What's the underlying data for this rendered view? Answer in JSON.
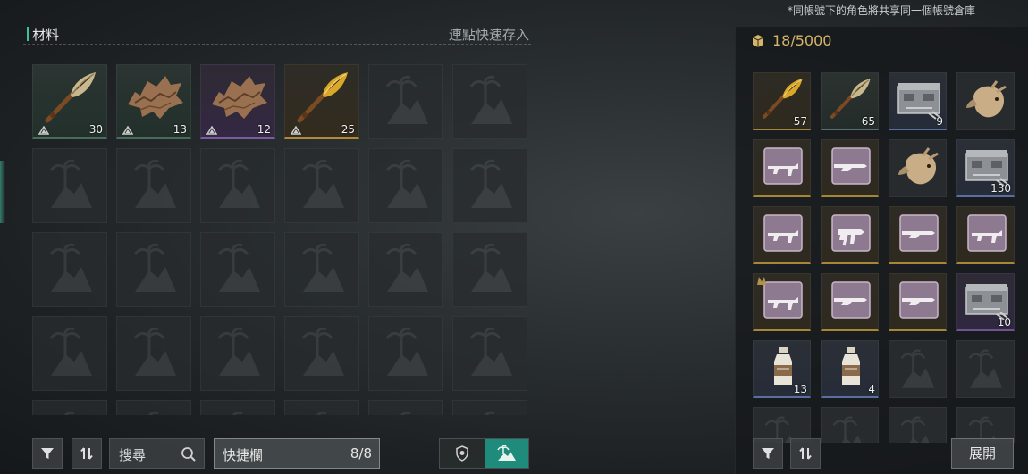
{
  "materials": {
    "title": "材料",
    "quick_store": "連點快速存入",
    "items": [
      {
        "icon": "bone-spear-icon",
        "rarity": "g",
        "count": "30"
      },
      {
        "icon": "animal-hide-icon",
        "rarity": "g",
        "count": "13"
      },
      {
        "icon": "animal-hide-icon",
        "rarity": "p",
        "count": "12"
      },
      {
        "icon": "golden-spear-icon",
        "rarity": "y",
        "count": "25"
      }
    ],
    "empty_slots": 26
  },
  "toolbar": {
    "search_label": "搜尋",
    "hotbar_label": "快捷欄",
    "hotbar_count": "8/8",
    "filter_icon": "filter-icon",
    "sort_icon": "sort-icon",
    "badge_icon": "badge-icon",
    "island_icon": "island-icon"
  },
  "storage": {
    "shared_note": "*同帳號下的角色將共享同一個帳號倉庫",
    "capacity": "18/5000",
    "items": [
      {
        "icon": "golden-spear-icon",
        "rarity": "y",
        "count": "57"
      },
      {
        "icon": "bone-spear-icon",
        "rarity": "g",
        "count": "65"
      },
      {
        "icon": "ammo-crate-icon",
        "rarity": "b",
        "count": "9"
      },
      {
        "icon": "deer-head-icon",
        "rarity": "",
        "count": ""
      },
      {
        "icon": "rifle-blueprint-icon",
        "rarity": "y",
        "count": ""
      },
      {
        "icon": "shotgun-blueprint-icon",
        "rarity": "y",
        "count": ""
      },
      {
        "icon": "deer-head-icon",
        "rarity": "",
        "count": ""
      },
      {
        "icon": "ammo-crate-icon",
        "rarity": "b",
        "count": "130"
      },
      {
        "icon": "rifle-blueprint-icon",
        "rarity": "y",
        "count": ""
      },
      {
        "icon": "smg-blueprint-icon",
        "rarity": "y",
        "count": ""
      },
      {
        "icon": "shotgun-blueprint-icon",
        "rarity": "y",
        "count": ""
      },
      {
        "icon": "rifle-blueprint-icon",
        "rarity": "y",
        "count": ""
      },
      {
        "icon": "rifle-blueprint-icon",
        "rarity": "y",
        "count": "",
        "tagged": true
      },
      {
        "icon": "shotgun-blueprint-icon",
        "rarity": "y",
        "count": ""
      },
      {
        "icon": "shotgun-blueprint-icon",
        "rarity": "y",
        "count": ""
      },
      {
        "icon": "ammo-crate-icon",
        "rarity": "p",
        "count": "10"
      },
      {
        "icon": "milk-bottle-icon",
        "rarity": "b",
        "count": "13"
      },
      {
        "icon": "milk-bottle-icon",
        "rarity": "b",
        "count": "4"
      }
    ],
    "empty_slots": 6,
    "expand_label": "展開"
  }
}
